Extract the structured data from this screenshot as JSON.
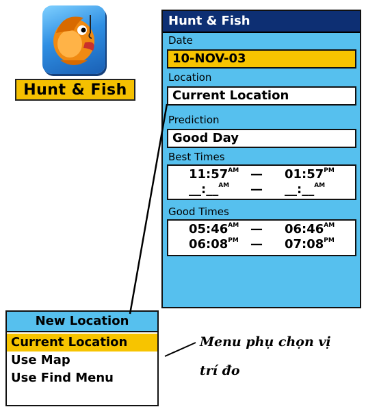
{
  "app": {
    "icon": "fish-icon",
    "label": "Hunt & Fish"
  },
  "panel": {
    "title": "Hunt & Fish",
    "date_label": "Date",
    "date_value": "10-NOV-03",
    "location_label": "Location",
    "location_value": "Current Location",
    "prediction_label": "Prediction",
    "prediction_value": "Good Day",
    "best_times_label": "Best Times",
    "best_times": [
      {
        "start": "11:57",
        "start_ampm": "AM",
        "end": "01:57",
        "end_ampm": "PM"
      },
      {
        "start": "__:__",
        "start_ampm": "AM",
        "end": "__:__",
        "end_ampm": "AM"
      }
    ],
    "good_times_label": "Good Times",
    "good_times": [
      {
        "start": "05:46",
        "start_ampm": "AM",
        "end": "06:46",
        "end_ampm": "AM"
      },
      {
        "start": "06:08",
        "start_ampm": "PM",
        "end": "07:08",
        "end_ampm": "PM"
      }
    ],
    "dash": "—"
  },
  "submenu": {
    "title": "New Location",
    "items": [
      "Current Location",
      "Use Map",
      "Use Find Menu"
    ]
  },
  "caption": {
    "line1": "Menu phụ chọn vị",
    "line2": "trí đo"
  },
  "colors": {
    "panel_bg": "#56c0ee",
    "header_bg": "#0d2f73",
    "highlight": "#f7c400"
  }
}
